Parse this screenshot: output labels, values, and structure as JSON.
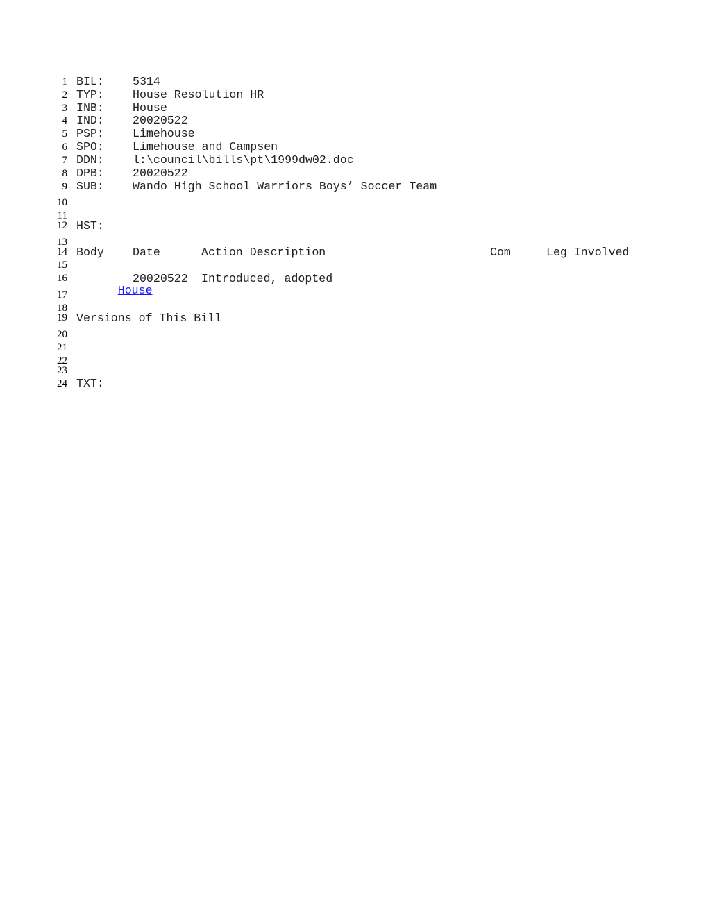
{
  "line_numbers": [
    "1",
    "2",
    "3",
    "4",
    "5",
    "6",
    "7",
    "8",
    "9",
    "10",
    "11",
    "12",
    "13",
    "14",
    "15",
    "16",
    "17",
    "18",
    "19",
    "20",
    "21",
    "22",
    "23",
    "24"
  ],
  "fields": [
    {
      "label": "BIL:",
      "value": "5314"
    },
    {
      "label": "TYP:",
      "value": "House Resolution HR"
    },
    {
      "label": "INB:",
      "value": "House"
    },
    {
      "label": "IND:",
      "value": "20020522"
    },
    {
      "label": "PSP:",
      "value": "Limehouse"
    },
    {
      "label": "SPO:",
      "value": "Limehouse and Campsen"
    },
    {
      "label": "DDN:",
      "value": "l:\\council\\bills\\pt\\1999dw02.doc"
    },
    {
      "label": "DPB:",
      "value": "20020522"
    },
    {
      "label": "SUB:",
      "value": "Wando High School Warriors Boys’ Soccer Team"
    }
  ],
  "history": {
    "label": "HST:",
    "columns": [
      "Body",
      "Date",
      "Action Description",
      "Com",
      "Leg Involved"
    ],
    "rows": [
      {
        "body": "House",
        "date": "20020522",
        "action": "Introduced, adopted",
        "com": "",
        "leg": ""
      }
    ]
  },
  "versions_heading": "Versions of This Bill",
  "text_label": "TXT:",
  "colors": {
    "link": "#1a1aff",
    "text": "#222222"
  }
}
